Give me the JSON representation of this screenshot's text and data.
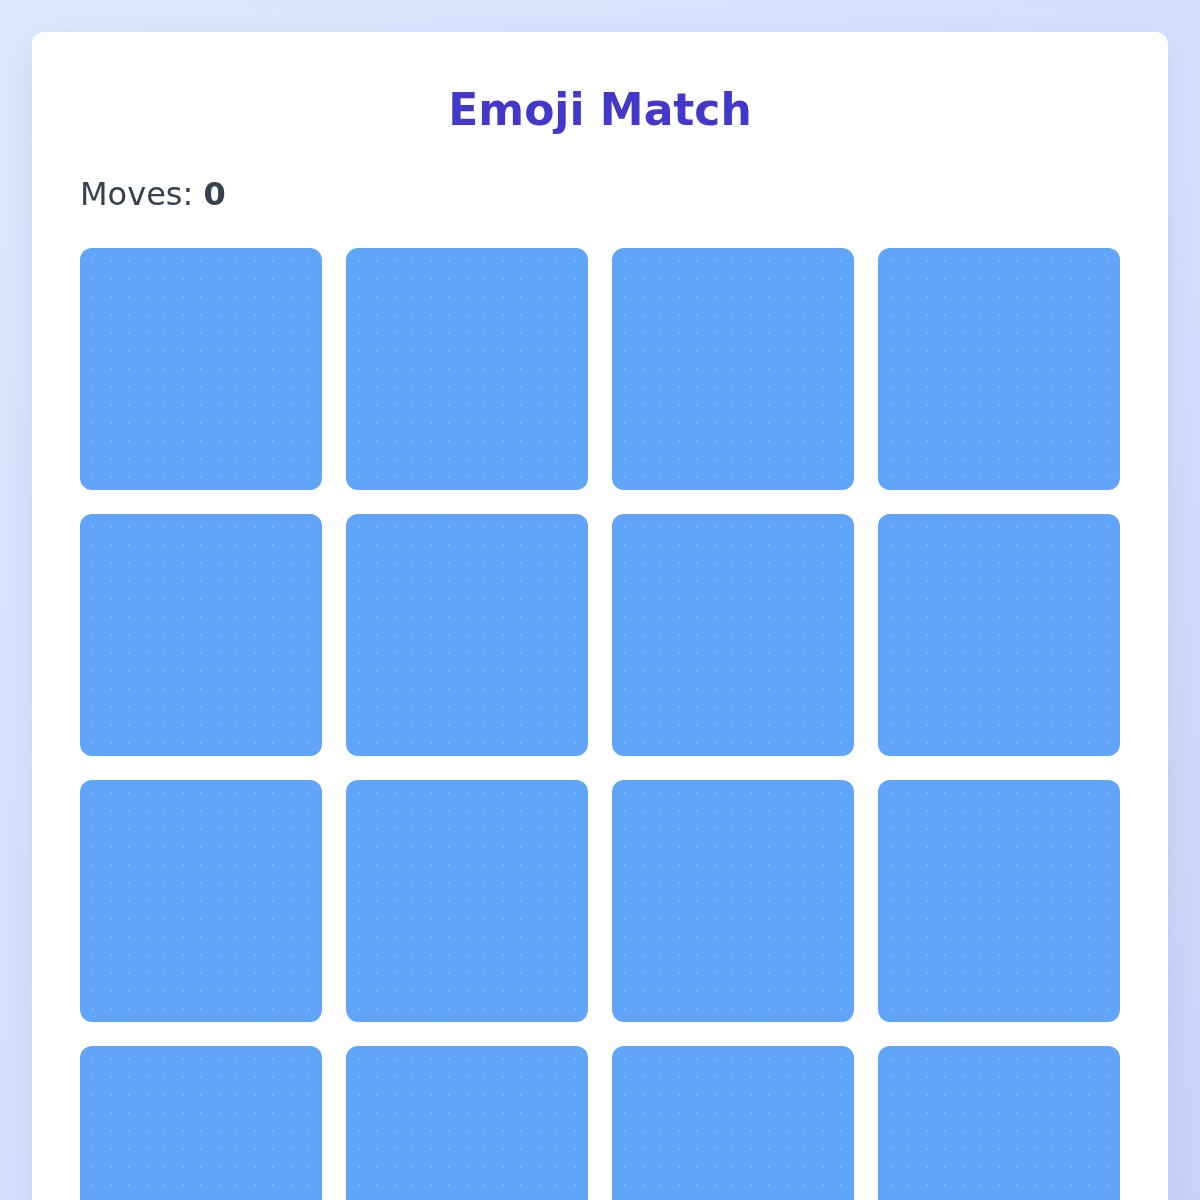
{
  "title": "Emoji Match",
  "moves": "Moves: **0**",
  "cards": [
    {
      "face_up": false
    },
    {
      "face_up": false
    },
    {
      "face_up": false
    },
    {
      "face_up": false
    },
    {
      "face_up": false
    },
    {
      "face_up": false
    },
    {
      "face_up": false
    },
    {
      "face_up": false
    },
    {
      "face_up": false
    },
    {
      "face_up": false
    },
    {
      "face_up": false
    },
    {
      "face_up": false
    },
    {
      "face_up": false
    },
    {
      "face_up": false
    },
    {
      "face_up": false
    },
    {
      "face_up": false
    }
  ]
}
